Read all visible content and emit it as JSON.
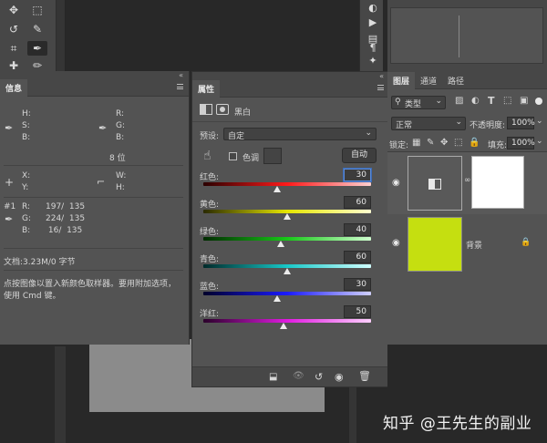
{
  "info_panel": {
    "tab": "信息",
    "rgb_labels": [
      "R:",
      "G:",
      "B:"
    ],
    "xy_labels": [
      "X:",
      "Y:"
    ],
    "wh_labels": [
      "W:",
      "H:"
    ],
    "hsb_labels": [
      "H:",
      "S:",
      "B:"
    ],
    "bit_depth": "8 位",
    "sample_index": "#1",
    "sample": [
      {
        "ch": "R:",
        "val": "197/  135"
      },
      {
        "ch": "G:",
        "val": "224/  135"
      },
      {
        "ch": "B:",
        "val": " 16/  135"
      }
    ],
    "doc_size": "文档:3.23M/0 字节",
    "hint_line1": "点按图像以置入新颜色取样器。要用附加选项，",
    "hint_line2": "使用 Cmd 键。"
  },
  "properties_panel": {
    "tab": "属性",
    "adjustment_name": "黑白",
    "preset_label": "预设:",
    "preset_value": "自定",
    "tint_label": "色调",
    "auto_button": "自动",
    "sliders": [
      {
        "label": "红色:",
        "value": "30",
        "percent": 44
      },
      {
        "label": "黄色:",
        "value": "60",
        "percent": 50
      },
      {
        "label": "绿色:",
        "value": "40",
        "percent": 46
      },
      {
        "label": "青色:",
        "value": "60",
        "percent": 50
      },
      {
        "label": "蓝色:",
        "value": "30",
        "percent": 44
      },
      {
        "label": "洋红:",
        "value": "50",
        "percent": 48
      }
    ]
  },
  "layers_panel": {
    "tabs": [
      "图层",
      "通道",
      "路径"
    ],
    "filter_kind": "类型",
    "blend_mode": "正常",
    "opacity_label": "不透明度:",
    "opacity_value": "100%",
    "lock_label": "锁定:",
    "fill_label": "填充:",
    "fill_value": "100%",
    "layers": [
      {
        "name": ""
      },
      {
        "name": "背景"
      }
    ],
    "background_color": "#c5df10"
  },
  "watermark": "知乎 @王先生的副业",
  "colors": {
    "panel": "#535353",
    "panel_header": "#474747",
    "canvas": "#282828",
    "focus": "#5b8ad6"
  }
}
